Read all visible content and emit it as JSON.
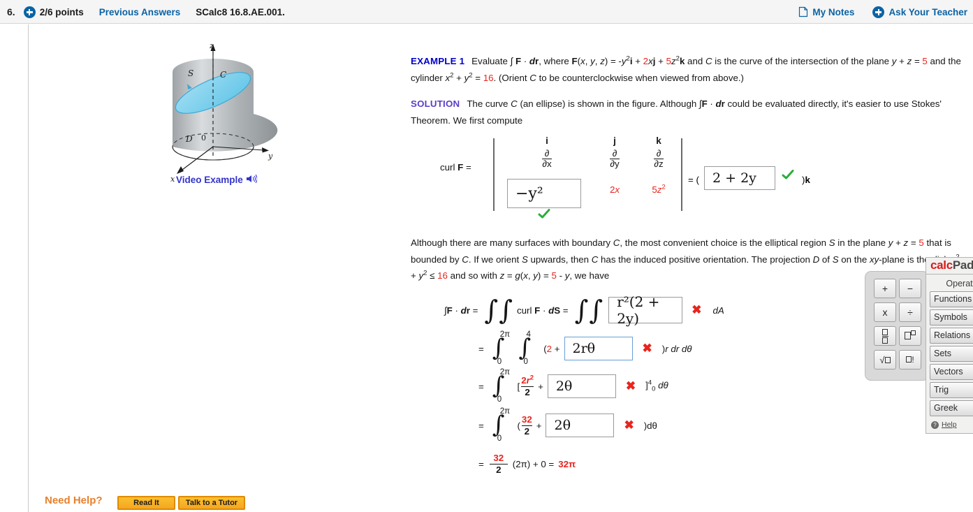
{
  "header": {
    "question_number": "6.",
    "points": "2/6 points",
    "previous_answers": "Previous Answers",
    "question_code": "SCalc8 16.8.AE.001.",
    "my_notes": "My Notes",
    "ask_your_teacher": "Ask Your Teacher",
    "accent_blue": "#0b63a5"
  },
  "figure": {
    "axis_z": "z",
    "axis_y": "y",
    "axis_x": "x",
    "label_S": "S",
    "label_C": "C",
    "label_D": "D",
    "label_origin": "0",
    "video_example": "Video Example",
    "surface_color": "#7fd3ef",
    "cylinder_color": "#b9bcbe"
  },
  "example": {
    "label": "EXAMPLE 1",
    "line1_a": "Evaluate ∫ ",
    "text": "Evaluate ∫ F · dr, where F(x, y, z) = -y²i + 2xj + 5z²k and C is the curve of the intersection of the plane y + z = 5 and the cylinder x² + y² = 16. (Orient C to be counterclockwise when viewed from above.)",
    "red_vals": [
      "2",
      "5",
      "5",
      "16"
    ]
  },
  "solution": {
    "label": "SOLUTION",
    "text": "The curve C (an ellipse) is shown in the figure. Although ∫F · dr could be evaluated directly, it's easier to use Stokes' Theorem. We first compute"
  },
  "curl": {
    "label": "curl F =",
    "col_i": "i",
    "col_j": "j",
    "col_k": "k",
    "d_dx_num": "∂",
    "d_dx_den": "∂x",
    "d_dy_num": "∂",
    "d_dy_den": "∂y",
    "d_dz_num": "∂",
    "d_dz_den": "∂z",
    "answer_i": "−y²",
    "entry_j": "2x",
    "entry_k": "5z²",
    "equals_open": "= (",
    "answer_k": "2 + 2y",
    "close_k": ")k",
    "status_i": "correct",
    "status_k": "correct"
  },
  "paragraph2": {
    "text": "Although there are many surfaces with boundary C, the most convenient choice is the elliptical region S in the plane y + z = 5 that is bounded by C. If we orient S upwards, then C has the induced positive orientation. The projection D of S on the xy-plane is the disk x² + y² ≤ 16 and so with z = g(x, y) = 5 - y, we have"
  },
  "equations": {
    "line1": {
      "lhs": "∫F · dr =",
      "mid": "curl F · dS =",
      "answer": "r²(2 + 2y)",
      "status": "incorrect",
      "trailing": "dA"
    },
    "line2": {
      "eq": "=",
      "upper1": "2π",
      "lower1": "0",
      "upper2": "4",
      "lower2": "0",
      "prefix": "(",
      "red_term": "2",
      "plus": "+",
      "answer": "2rθ",
      "status": "incorrect",
      "trailing": ")r dr dθ"
    },
    "line3": {
      "eq": "=",
      "upper1": "2π",
      "lower1": "0",
      "bracket": "[",
      "frac_num": "2r²",
      "frac_den": "2",
      "plus": "+",
      "answer": "2θ",
      "status": "incorrect",
      "close_bracket": "]",
      "close_sup": "4",
      "close_sub": "0",
      "trailing": "dθ"
    },
    "line4": {
      "eq": "=",
      "upper1": "2π",
      "lower1": "0",
      "prefix": "(",
      "frac_num": "32",
      "frac_den": "2",
      "plus": "+",
      "answer": "2θ",
      "status": "incorrect",
      "trailing": ")dθ"
    },
    "line5": {
      "eq": "=",
      "frac_num": "32",
      "frac_den": "2",
      "rest": "(2π) + 0 =",
      "result": "32π"
    }
  },
  "calcpad": {
    "title_calc": "calc",
    "title_pad": "Pad",
    "operations_label": "Operations",
    "buttons": [
      "Functions",
      "Symbols",
      "Relations",
      "Sets",
      "Vectors",
      "Trig",
      "Greek"
    ],
    "help": "Help",
    "ops": [
      "+",
      "−",
      "x",
      "÷",
      "fraction",
      "exponent",
      "square-root",
      "factorial"
    ]
  },
  "need_help": {
    "label": "Need Help?",
    "read_it": "Read It",
    "talk_to_tutor": "Talk to a Tutor"
  }
}
